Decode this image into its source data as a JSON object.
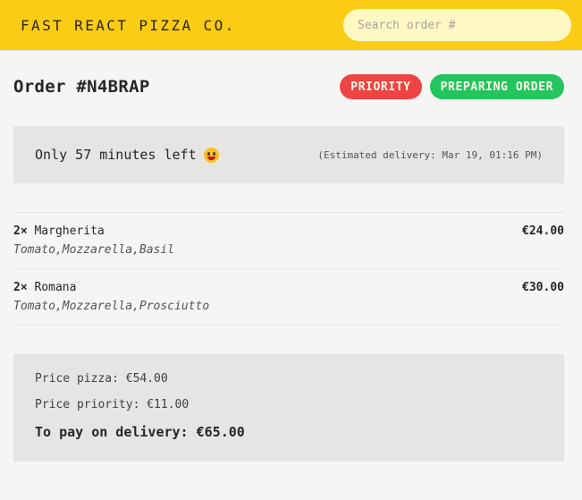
{
  "header": {
    "brand": "FAST REACT PIZZA CO.",
    "search_placeholder": "Search order #"
  },
  "order": {
    "title": "Order #N4BRAP",
    "badges": {
      "priority": "PRIORITY",
      "status": "PREPARING ORDER"
    },
    "eta": {
      "left": "Only 57 minutes left",
      "emoji_icon": "grinning-face-icon",
      "estimated": "(Estimated delivery: Mar 19, 01:16 PM)"
    },
    "items": [
      {
        "qty": "2×",
        "name": "Margherita",
        "price": "€24.00",
        "ingredients": "Tomato,Mozzarella,Basil"
      },
      {
        "qty": "2×",
        "name": "Romana",
        "price": "€30.00",
        "ingredients": "Tomato,Mozzarella,Prosciutto"
      }
    ],
    "summary": {
      "price_pizza": "Price pizza: €54.00",
      "price_priority": "Price priority: €11.00",
      "total": "To pay on delivery: €65.00"
    }
  },
  "colors": {
    "header_bg": "#facc15",
    "priority_badge": "#ef4444",
    "status_badge": "#22c55e",
    "panel_bg": "#e7e5e4"
  }
}
